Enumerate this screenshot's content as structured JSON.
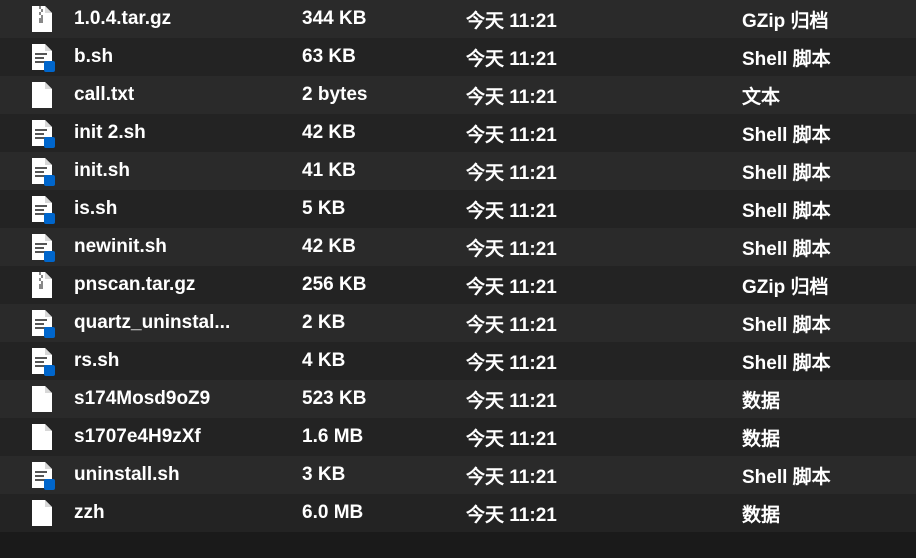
{
  "files": [
    {
      "name": "1.0.4.tar.gz",
      "size": "344 KB",
      "date": "今天 11:21",
      "kind": "GZip 归档",
      "icon": "archive"
    },
    {
      "name": "b.sh",
      "size": "63 KB",
      "date": "今天 11:21",
      "kind": "Shell 脚本",
      "icon": "shell"
    },
    {
      "name": "call.txt",
      "size": "2 bytes",
      "date": "今天 11:21",
      "kind": "文本",
      "icon": "file"
    },
    {
      "name": "init 2.sh",
      "size": "42 KB",
      "date": "今天 11:21",
      "kind": "Shell 脚本",
      "icon": "shell"
    },
    {
      "name": "init.sh",
      "size": "41 KB",
      "date": "今天 11:21",
      "kind": "Shell 脚本",
      "icon": "shell"
    },
    {
      "name": "is.sh",
      "size": "5 KB",
      "date": "今天 11:21",
      "kind": "Shell 脚本",
      "icon": "shell"
    },
    {
      "name": "newinit.sh",
      "size": "42 KB",
      "date": "今天 11:21",
      "kind": "Shell 脚本",
      "icon": "shell"
    },
    {
      "name": "pnscan.tar.gz",
      "size": "256 KB",
      "date": "今天 11:21",
      "kind": "GZip 归档",
      "icon": "archive"
    },
    {
      "name": "quartz_uninstal...",
      "size": "2 KB",
      "date": "今天 11:21",
      "kind": "Shell 脚本",
      "icon": "shell"
    },
    {
      "name": "rs.sh",
      "size": "4 KB",
      "date": "今天 11:21",
      "kind": "Shell 脚本",
      "icon": "shell"
    },
    {
      "name": "s174Mosd9oZ9",
      "size": "523 KB",
      "date": "今天 11:21",
      "kind": "数据",
      "icon": "file"
    },
    {
      "name": "s1707e4H9zXf",
      "size": "1.6 MB",
      "date": "今天 11:21",
      "kind": "数据",
      "icon": "file"
    },
    {
      "name": "uninstall.sh",
      "size": "3 KB",
      "date": "今天 11:21",
      "kind": "Shell 脚本",
      "icon": "shell"
    },
    {
      "name": "zzh",
      "size": "6.0 MB",
      "date": "今天 11:21",
      "kind": "数据",
      "icon": "file"
    }
  ]
}
